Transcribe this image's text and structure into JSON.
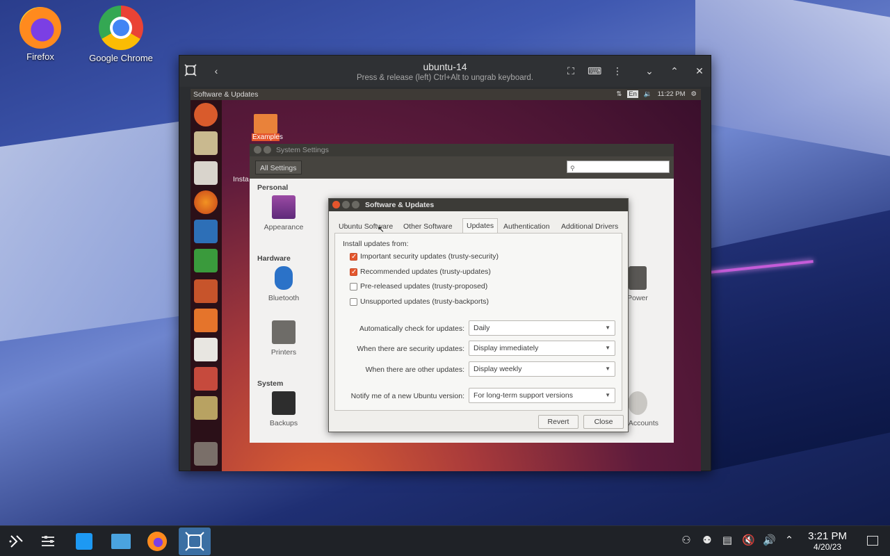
{
  "desktop": {
    "icons": [
      {
        "label": "Firefox"
      },
      {
        "label": "Google Chrome"
      }
    ]
  },
  "vm_window": {
    "title": "ubuntu-14",
    "subtitle": "Press & release (left) Ctrl+Alt to ungrab keyboard."
  },
  "guest": {
    "top_panel": {
      "app_name": "Software & Updates",
      "lang": "En",
      "time": "11:22 PM"
    },
    "desktop_folder": {
      "label": "Examples"
    },
    "partial_text": "Insta",
    "system_settings": {
      "title": "System Settings",
      "all_settings": "All Settings",
      "categories": {
        "personal": "Personal",
        "hardware": "Hardware",
        "system": "System"
      },
      "items": {
        "appearance": "Appearance",
        "bluetooth": "Bluetooth",
        "printers": "Printers",
        "backups": "Backups",
        "power": "Power",
        "user_accounts": "ser Accounts"
      }
    },
    "dialog": {
      "title": "Software & Updates",
      "tabs": [
        "Ubuntu Software",
        "Other Software",
        "Updates",
        "Authentication",
        "Additional Drivers"
      ],
      "active_tab": "Updates",
      "install_from": "Install updates from:",
      "checkboxes": [
        {
          "label": "Important security updates (trusty-security)",
          "checked": true
        },
        {
          "label": "Recommended updates (trusty-updates)",
          "checked": true
        },
        {
          "label": "Pre-released updates (trusty-proposed)",
          "checked": false
        },
        {
          "label": "Unsupported updates (trusty-backports)",
          "checked": false
        }
      ],
      "settings": [
        {
          "label": "Automatically check for updates:",
          "value": "Daily"
        },
        {
          "label": "When there are security updates:",
          "value": "Display immediately"
        },
        {
          "label": "When there are other updates:",
          "value": "Display weekly"
        },
        {
          "label": "Notify me of a new Ubuntu version:",
          "value": "For long-term support versions"
        }
      ],
      "buttons": {
        "revert": "Revert",
        "close": "Close"
      }
    }
  },
  "taskbar": {
    "clock_time": "3:21 PM",
    "clock_date": "4/20/23"
  }
}
